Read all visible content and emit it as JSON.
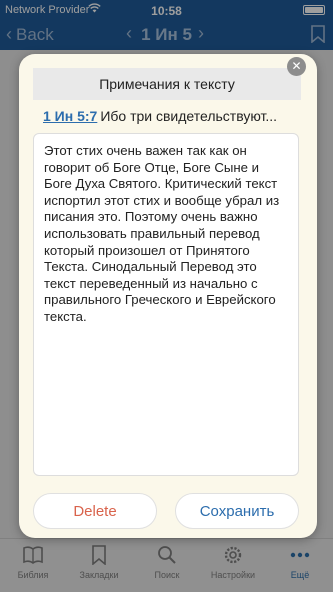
{
  "status_bar": {
    "carrier": "Network Provider",
    "time": "10:58"
  },
  "nav": {
    "back_label": "Back",
    "title": "1 Ин 5",
    "back_chevron": "‹",
    "prev_chevron": "‹",
    "next_chevron": "›",
    "bookmark_icon": "bookmark-icon"
  },
  "dialog": {
    "title": "Примечания к тексту",
    "close_glyph": "✕",
    "verse_ref": "1 Ин 5:7",
    "verse_text": "Ибо три свидетельствуют...",
    "note": "Этот стих очень важен так как он говорит об Боге Отце, Боге Сыне и Боге Духа Святого. Критический текст испортил этот стих и вообще убрал из писания это. Поэтому очень важно использовать правильный перевод который произошел от Принятого Текста. Синодальный Перевод это текст переведенный из начально с правильного Греческого и Еврейского текста.",
    "delete_label": "Delete",
    "save_label": "Сохранить"
  },
  "tabs": [
    {
      "label": "Библия",
      "icon": "book-icon"
    },
    {
      "label": "Закладки",
      "icon": "bookmark-icon"
    },
    {
      "label": "Поиск",
      "icon": "search-icon"
    },
    {
      "label": "Настройки",
      "icon": "gear-icon"
    },
    {
      "label": "Ещё",
      "icon": "more-icon"
    }
  ],
  "colors": {
    "header": "#1f5b9a",
    "accent": "#2c6dad",
    "delete": "#d9634c",
    "dialog_bg": "#fbf8ea"
  }
}
